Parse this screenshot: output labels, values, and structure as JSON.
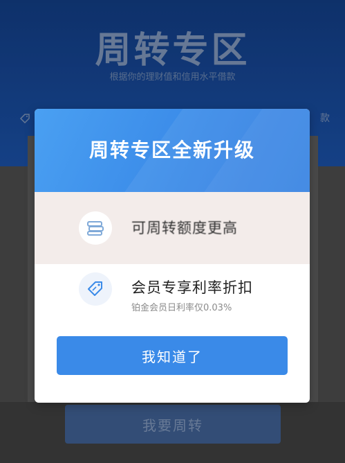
{
  "background": {
    "hero_title": "周转专区",
    "hero_subtitle": "根据你的理财值和信用水平借款",
    "hero_tag_right": "款",
    "action_button": "我要周转"
  },
  "modal": {
    "title": "周转专区全新升级",
    "features": [
      {
        "icon": "money-stack-icon",
        "title": "可周转额度更高",
        "desc": ""
      },
      {
        "icon": "tag-icon",
        "title": "会员专享利率折扣",
        "desc": "铂金会员日利率仅0.03%"
      }
    ],
    "confirm_label": "我知道了"
  },
  "colors": {
    "hero_blue": "#1a4fa3",
    "modal_header_blue": "#3a8ae8",
    "button_blue": "#3a8ae8",
    "icon_blue": "#3a8ae8"
  }
}
